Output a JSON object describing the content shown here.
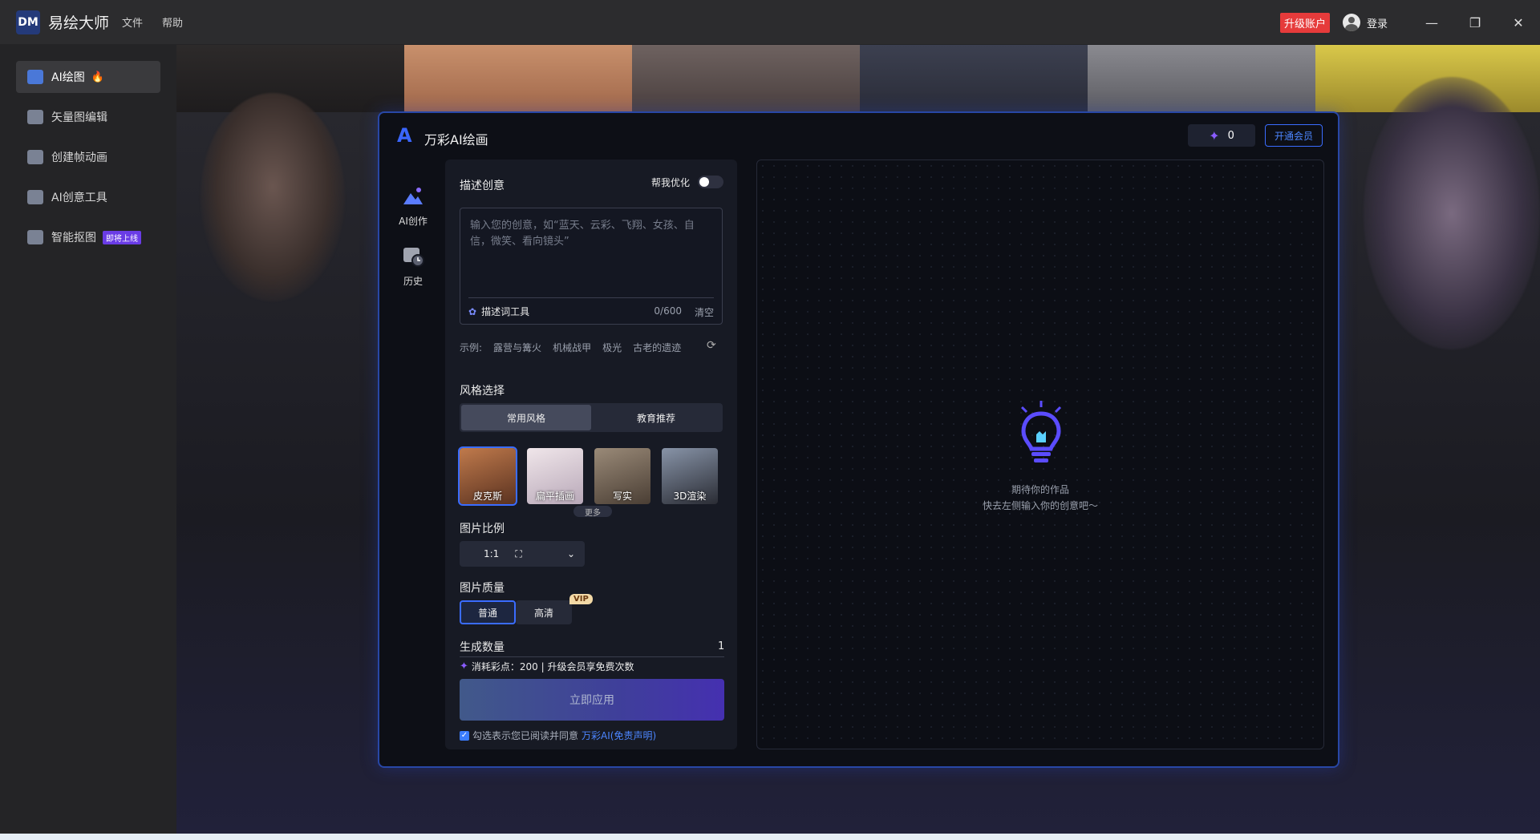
{
  "titlebar": {
    "logo": "DM",
    "app_name": "易绘大师",
    "menu": [
      "文件",
      "帮助"
    ],
    "upgrade": "升级账户",
    "login": "登录"
  },
  "sidebar": {
    "items": [
      {
        "label": "AI绘图",
        "icon": "ai-paint-icon"
      },
      {
        "label": "矢量图编辑",
        "icon": "vector-edit-icon"
      },
      {
        "label": "创建帧动画",
        "icon": "frame-animation-icon"
      },
      {
        "label": "AI创意工具",
        "icon": "ai-creative-tools-icon"
      },
      {
        "label": "智能抠图",
        "icon": "smart-cutout-icon",
        "badge": "即将上线"
      }
    ]
  },
  "dialog": {
    "title": "万彩AI绘画",
    "points": "0",
    "vip_button": "开通会员",
    "nav": [
      {
        "label": "AI创作"
      },
      {
        "label": "历史"
      }
    ],
    "describe_title": "描述创意",
    "optimize_label": "帮我优化",
    "placeholder": "输入您的创意，如“蓝天、云彩、飞翔、女孩、自信，微笑、看向镜头”",
    "prompt_tool": "描述词工具",
    "char_count": "0/600",
    "clear": "清空",
    "examples_label": "示例:",
    "examples": [
      "露营与篝火",
      "机械战甲",
      "极光",
      "古老的遗迹"
    ],
    "style_title": "风格选择",
    "style_tabs": [
      "常用风格",
      "教育推荐"
    ],
    "styles": [
      "皮克斯",
      "扁平插画",
      "写实",
      "3D渲染"
    ],
    "more": "更多",
    "ratio_title": "图片比例",
    "ratio_value": "1:1",
    "quality_title": "图片质量",
    "quality_options": [
      "普通",
      "高清"
    ],
    "vip_tag": "VIP",
    "count_title": "生成数量",
    "count_value": "1",
    "consume_text": "消耗彩点：200 | 升级会员享免费次数",
    "apply_button": "立即应用",
    "agree_text": "勾选表示您已阅读并同意",
    "agree_link": "万彩AI(免责声明)",
    "empty_line1": "期待你的作品",
    "empty_line2": "快去左侧输入你的创意吧～"
  },
  "colors": {
    "accent": "#3a6cff",
    "upgrade_red": "#e63b3b",
    "badge_purple": "#6a3ce6"
  }
}
